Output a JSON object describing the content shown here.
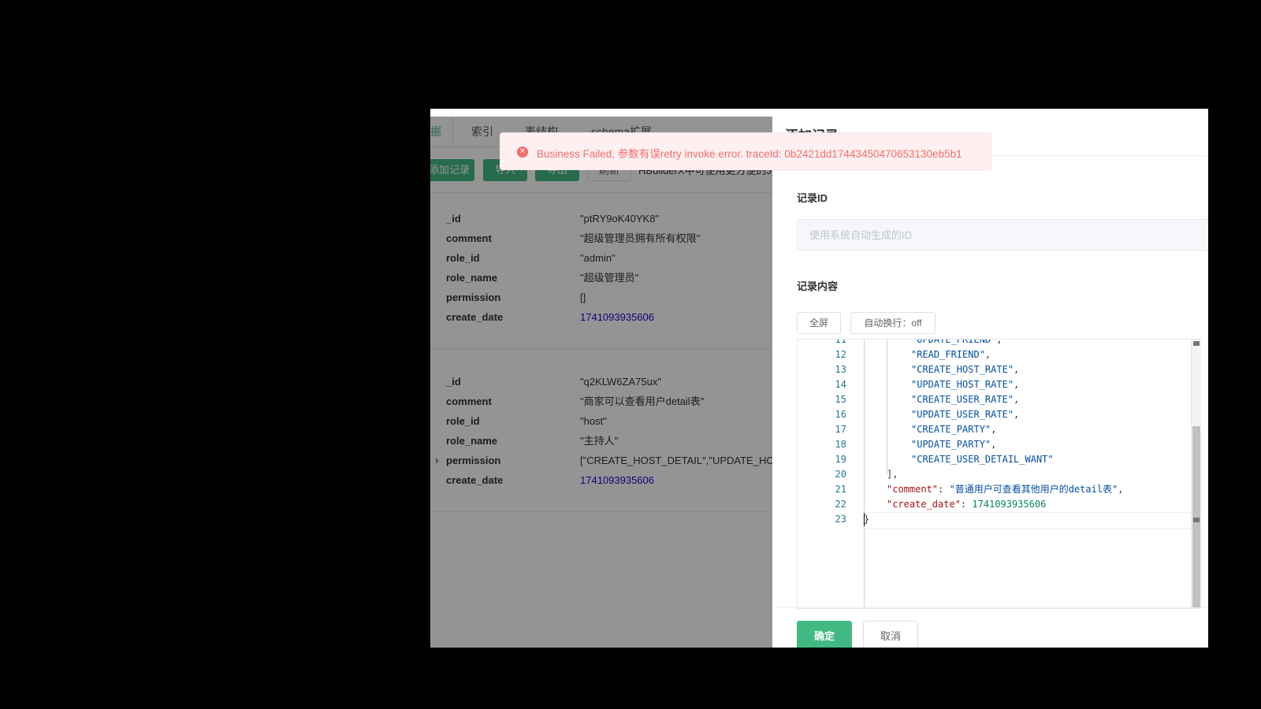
{
  "tabs": [
    {
      "label": "据"
    },
    {
      "label": "索引"
    },
    {
      "label": "表结构"
    },
    {
      "label": "schema扩展"
    }
  ],
  "toolbar": {
    "add_label": "添加记录",
    "import_label": "导入",
    "export_label": "导出",
    "refresh_label": "刷新",
    "hint": "HBuilderX中可使用更方便的JQL"
  },
  "records": [
    {
      "fields": [
        {
          "key": "_id",
          "value": "\"ptRY9oK40YK8\""
        },
        {
          "key": "comment",
          "value": "\"超级管理员拥有所有权限\""
        },
        {
          "key": "role_id",
          "value": "\"admin\""
        },
        {
          "key": "role_name",
          "value": "\"超级管理员\""
        },
        {
          "key": "permission",
          "value": "[]"
        },
        {
          "key": "create_date",
          "value": "1741093935606"
        }
      ]
    },
    {
      "fields": [
        {
          "key": "_id",
          "value": "\"q2KLW6ZA75ux\""
        },
        {
          "key": "comment",
          "value": "\"商家可以查看用户detail表\""
        },
        {
          "key": "role_id",
          "value": "\"host\""
        },
        {
          "key": "role_name",
          "value": "\"主持人\""
        },
        {
          "key": "permission",
          "value": "[\"CREATE_HOST_DETAIL\",\"UPDATE_HOST_DETAIL\""
        },
        {
          "key": "create_date",
          "value": "1741093935606"
        }
      ]
    }
  ],
  "drawer": {
    "title": "添加记录",
    "record_id_label": "记录ID",
    "record_id_placeholder": "使用系统自动生成的ID",
    "record_content_label": "记录内容",
    "fullscreen_label": "全屏",
    "wrap_label": "自动换行：off",
    "confirm_label": "确定",
    "cancel_label": "取消"
  },
  "editor": {
    "lines": [
      {
        "n": "11",
        "k": "",
        "v": "\"UPDATE_FRIEND\"",
        "p": ",",
        "indent": 2,
        "vtype": "str"
      },
      {
        "n": "12",
        "k": "",
        "v": "\"READ_FRIEND\"",
        "p": ",",
        "indent": 2,
        "vtype": "str"
      },
      {
        "n": "13",
        "k": "",
        "v": "\"CREATE_HOST_RATE\"",
        "p": ",",
        "indent": 2,
        "vtype": "str"
      },
      {
        "n": "14",
        "k": "",
        "v": "\"UPDATE_HOST_RATE\"",
        "p": ",",
        "indent": 2,
        "vtype": "str"
      },
      {
        "n": "15",
        "k": "",
        "v": "\"CREATE_USER_RATE\"",
        "p": ",",
        "indent": 2,
        "vtype": "str"
      },
      {
        "n": "16",
        "k": "",
        "v": "\"UPDATE_USER_RATE\"",
        "p": ",",
        "indent": 2,
        "vtype": "str"
      },
      {
        "n": "17",
        "k": "",
        "v": "\"CREATE_PARTY\"",
        "p": ",",
        "indent": 2,
        "vtype": "str"
      },
      {
        "n": "18",
        "k": "",
        "v": "\"UPDATE_PARTY\"",
        "p": ",",
        "indent": 2,
        "vtype": "str"
      },
      {
        "n": "19",
        "k": "",
        "v": "\"CREATE_USER_DETAIL_WANT\"",
        "p": "",
        "indent": 2,
        "vtype": "str"
      },
      {
        "n": "20",
        "k": "",
        "v": "",
        "p": "],",
        "indent": 1,
        "vtype": "punc"
      },
      {
        "n": "21",
        "k": "\"comment\"",
        "v": "\"普通用户可查看其他用户的detail表\"",
        "p": ",",
        "indent": 1,
        "vtype": "str"
      },
      {
        "n": "22",
        "k": "\"create_date\"",
        "v": "1741093935606",
        "p": "",
        "indent": 1,
        "vtype": "num"
      },
      {
        "n": "23",
        "k": "",
        "v": "",
        "p": "}",
        "indent": 0,
        "vtype": "punc"
      }
    ]
  },
  "toast": {
    "message": "Business Failed, 参数有误retry invoke error. traceId: 0b2421dd17443450470653130eb5b1"
  },
  "colors": {
    "primary": "#42b983",
    "error": "#f56c6c"
  }
}
